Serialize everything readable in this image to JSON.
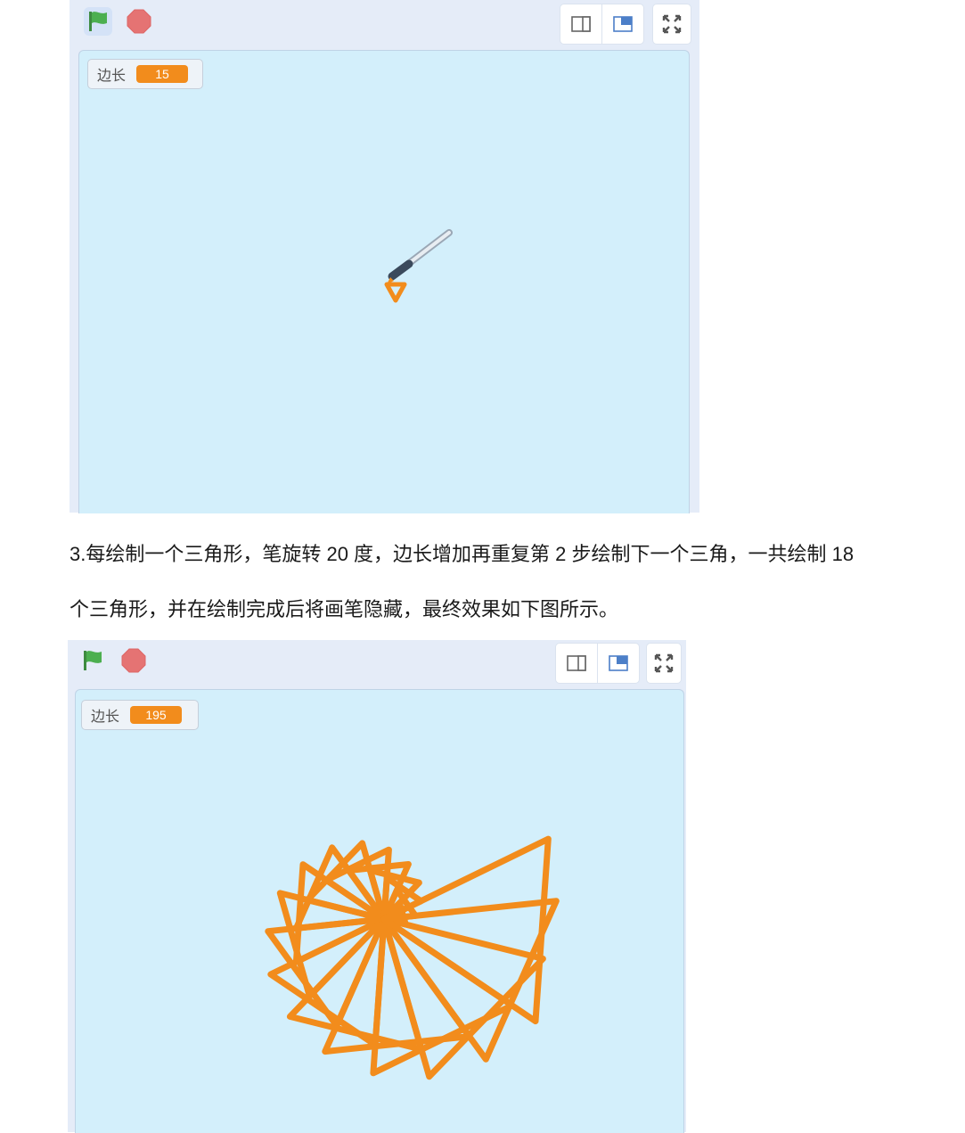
{
  "stage1": {
    "variable_monitor": {
      "label": "边长",
      "value": "15"
    }
  },
  "instruction": {
    "line1": "3.每绘制一个三角形，笔旋转 20 度，边长增加再重复第 2 步绘制下一个三角，一共绘制 18",
    "line2": "个三角形，并在绘制完成后将画笔隐藏，最终效果如下图所示。"
  },
  "stage2": {
    "variable_monitor": {
      "label": "边长",
      "value": "195"
    }
  },
  "colors": {
    "pen": "#f28c1c",
    "stage_bg": "#d3effb",
    "flag": "#4caf50",
    "stop": "#e57373"
  },
  "icons": [
    "green-flag-icon",
    "stop-icon",
    "small-stage-icon",
    "normal-stage-icon",
    "fullscreen-icon",
    "pen-sprite-icon"
  ]
}
